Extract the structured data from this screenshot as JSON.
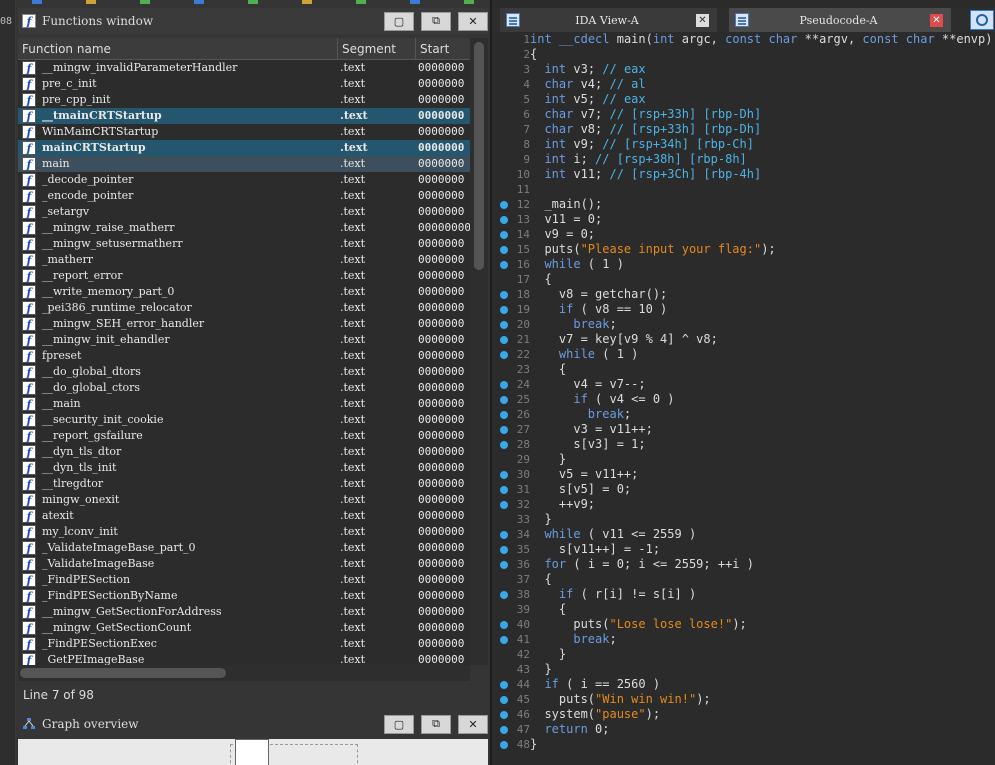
{
  "left_panel": {
    "side_number": "08",
    "functions_window": {
      "title": "Functions window",
      "columns": {
        "name": "Function name",
        "segment": "Segment",
        "start": "Start"
      },
      "rows": [
        {
          "name": "__mingw_invalidParameterHandler",
          "segment": ".text",
          "start": "0000000"
        },
        {
          "name": "pre_c_init",
          "segment": ".text",
          "start": "0000000"
        },
        {
          "name": "pre_cpp_init",
          "segment": ".text",
          "start": "0000000"
        },
        {
          "name": "__tmainCRTStartup",
          "segment": ".text",
          "start": "0000000"
        },
        {
          "name": "WinMainCRTStartup",
          "segment": ".text",
          "start": "0000000"
        },
        {
          "name": "mainCRTStartup",
          "segment": ".text",
          "start": "0000000"
        },
        {
          "name": "main",
          "segment": ".text",
          "start": "0000000"
        },
        {
          "name": "_decode_pointer",
          "segment": ".text",
          "start": "0000000"
        },
        {
          "name": "_encode_pointer",
          "segment": ".text",
          "start": "0000000"
        },
        {
          "name": "_setargv",
          "segment": ".text",
          "start": "0000000"
        },
        {
          "name": "__mingw_raise_matherr",
          "segment": ".text",
          "start": "00000000"
        },
        {
          "name": "__mingw_setusermatherr",
          "segment": ".text",
          "start": "0000000"
        },
        {
          "name": "_matherr",
          "segment": ".text",
          "start": "0000000"
        },
        {
          "name": "__report_error",
          "segment": ".text",
          "start": "0000000"
        },
        {
          "name": "__write_memory_part_0",
          "segment": ".text",
          "start": "0000000"
        },
        {
          "name": "_pei386_runtime_relocator",
          "segment": ".text",
          "start": "0000000"
        },
        {
          "name": "__mingw_SEH_error_handler",
          "segment": ".text",
          "start": "0000000"
        },
        {
          "name": "__mingw_init_ehandler",
          "segment": ".text",
          "start": "0000000"
        },
        {
          "name": "fpreset",
          "segment": ".text",
          "start": "0000000"
        },
        {
          "name": "__do_global_dtors",
          "segment": ".text",
          "start": "0000000"
        },
        {
          "name": "__do_global_ctors",
          "segment": ".text",
          "start": "0000000"
        },
        {
          "name": "__main",
          "segment": ".text",
          "start": "0000000"
        },
        {
          "name": "__security_init_cookie",
          "segment": ".text",
          "start": "0000000"
        },
        {
          "name": "__report_gsfailure",
          "segment": ".text",
          "start": "0000000"
        },
        {
          "name": "__dyn_tls_dtor",
          "segment": ".text",
          "start": "0000000"
        },
        {
          "name": "__dyn_tls_init",
          "segment": ".text",
          "start": "0000000"
        },
        {
          "name": "__tlregdtor",
          "segment": ".text",
          "start": "0000000"
        },
        {
          "name": "mingw_onexit",
          "segment": ".text",
          "start": "0000000"
        },
        {
          "name": "atexit",
          "segment": ".text",
          "start": "0000000"
        },
        {
          "name": "my_lconv_init",
          "segment": ".text",
          "start": "0000000"
        },
        {
          "name": "_ValidateImageBase_part_0",
          "segment": ".text",
          "start": "0000000"
        },
        {
          "name": "_ValidateImageBase",
          "segment": ".text",
          "start": "0000000"
        },
        {
          "name": "_FindPESection",
          "segment": ".text",
          "start": "0000000"
        },
        {
          "name": "_FindPESectionByName",
          "segment": ".text",
          "start": "0000000"
        },
        {
          "name": "__mingw_GetSectionForAddress",
          "segment": ".text",
          "start": "0000000"
        },
        {
          "name": "__mingw_GetSectionCount",
          "segment": ".text",
          "start": "0000000"
        },
        {
          "name": "_FindPESectionExec",
          "segment": ".text",
          "start": "0000000"
        },
        {
          "name": "_GetPEImageBase",
          "segment": ".text",
          "start": "0000000"
        }
      ],
      "selected_rows": [
        3,
        5
      ],
      "current_row": 6,
      "status": "Line 7 of 98"
    },
    "graph_overview": {
      "title": "Graph overview"
    }
  },
  "tabs": [
    {
      "label": "IDA View-A",
      "active": false
    },
    {
      "label": "Pseudocode-A",
      "active": true
    }
  ],
  "code_lines": [
    {
      "n": "1",
      "dot": false,
      "t": "int __cdecl main(int argc, const char **argv, const char **envp)"
    },
    {
      "n": "2",
      "dot": false,
      "t": "{"
    },
    {
      "n": "3",
      "dot": false,
      "t": "  int v3; // eax"
    },
    {
      "n": "4",
      "dot": false,
      "t": "  char v4; // al"
    },
    {
      "n": "5",
      "dot": false,
      "t": "  int v5; // eax"
    },
    {
      "n": "6",
      "dot": false,
      "t": "  char v7; // [rsp+33h] [rbp-Dh]"
    },
    {
      "n": "7",
      "dot": false,
      "t": "  char v8; // [rsp+33h] [rbp-Dh]"
    },
    {
      "n": "8",
      "dot": false,
      "t": "  int v9; // [rsp+34h] [rbp-Ch]"
    },
    {
      "n": "9",
      "dot": false,
      "t": "  int i; // [rsp+38h] [rbp-8h]"
    },
    {
      "n": "10",
      "dot": false,
      "t": "  int v11; // [rsp+3Ch] [rbp-4h]"
    },
    {
      "n": "11",
      "dot": false,
      "t": ""
    },
    {
      "n": "12",
      "dot": true,
      "t": "  _main();"
    },
    {
      "n": "13",
      "dot": true,
      "t": "  v11 = 0;"
    },
    {
      "n": "14",
      "dot": true,
      "t": "  v9 = 0;"
    },
    {
      "n": "15",
      "dot": true,
      "t": "  puts(\"Please input your flag:\");"
    },
    {
      "n": "16",
      "dot": true,
      "t": "  while ( 1 )"
    },
    {
      "n": "17",
      "dot": false,
      "t": "  {"
    },
    {
      "n": "18",
      "dot": true,
      "t": "    v8 = getchar();"
    },
    {
      "n": "19",
      "dot": true,
      "t": "    if ( v8 == 10 )"
    },
    {
      "n": "20",
      "dot": true,
      "t": "      break;"
    },
    {
      "n": "21",
      "dot": true,
      "t": "    v7 = key[v9 % 4] ^ v8;"
    },
    {
      "n": "22",
      "dot": true,
      "t": "    while ( 1 )"
    },
    {
      "n": "23",
      "dot": false,
      "t": "    {"
    },
    {
      "n": "24",
      "dot": true,
      "t": "      v4 = v7--;"
    },
    {
      "n": "25",
      "dot": true,
      "t": "      if ( v4 <= 0 )"
    },
    {
      "n": "26",
      "dot": true,
      "t": "        break;"
    },
    {
      "n": "27",
      "dot": true,
      "t": "      v3 = v11++;"
    },
    {
      "n": "28",
      "dot": true,
      "t": "      s[v3] = 1;"
    },
    {
      "n": "29",
      "dot": false,
      "t": "    }"
    },
    {
      "n": "30",
      "dot": true,
      "t": "    v5 = v11++;"
    },
    {
      "n": "31",
      "dot": true,
      "t": "    s[v5] = 0;"
    },
    {
      "n": "32",
      "dot": true,
      "t": "    ++v9;"
    },
    {
      "n": "33",
      "dot": false,
      "t": "  }"
    },
    {
      "n": "34",
      "dot": true,
      "t": "  while ( v11 <= 2559 )"
    },
    {
      "n": "35",
      "dot": true,
      "t": "    s[v11++] = -1;"
    },
    {
      "n": "36",
      "dot": true,
      "t": "  for ( i = 0; i <= 2559; ++i )"
    },
    {
      "n": "37",
      "dot": false,
      "t": "  {"
    },
    {
      "n": "38",
      "dot": true,
      "t": "    if ( r[i] != s[i] )"
    },
    {
      "n": "39",
      "dot": false,
      "t": "    {"
    },
    {
      "n": "40",
      "dot": true,
      "t": "      puts(\"Lose lose lose!\");"
    },
    {
      "n": "41",
      "dot": true,
      "t": "      break;"
    },
    {
      "n": "42",
      "dot": false,
      "t": "    }"
    },
    {
      "n": "43",
      "dot": false,
      "t": "  }"
    },
    {
      "n": "44",
      "dot": true,
      "t": "  if ( i == 2560 )"
    },
    {
      "n": "45",
      "dot": true,
      "t": "    puts(\"Win win win!\");"
    },
    {
      "n": "46",
      "dot": true,
      "t": "  system(\"pause\");"
    },
    {
      "n": "47",
      "dot": true,
      "t": "  return 0;"
    },
    {
      "n": "48",
      "dot": true,
      "t": "}"
    }
  ],
  "colors": {
    "selection": "#24566d",
    "current": "#3d4f5c",
    "keyword": "#6a9ce0",
    "string": "#e38a1f",
    "comment": "#4db3e6",
    "breakpoint_dot": "#37a8e8",
    "close_active": "#e04b4b"
  }
}
